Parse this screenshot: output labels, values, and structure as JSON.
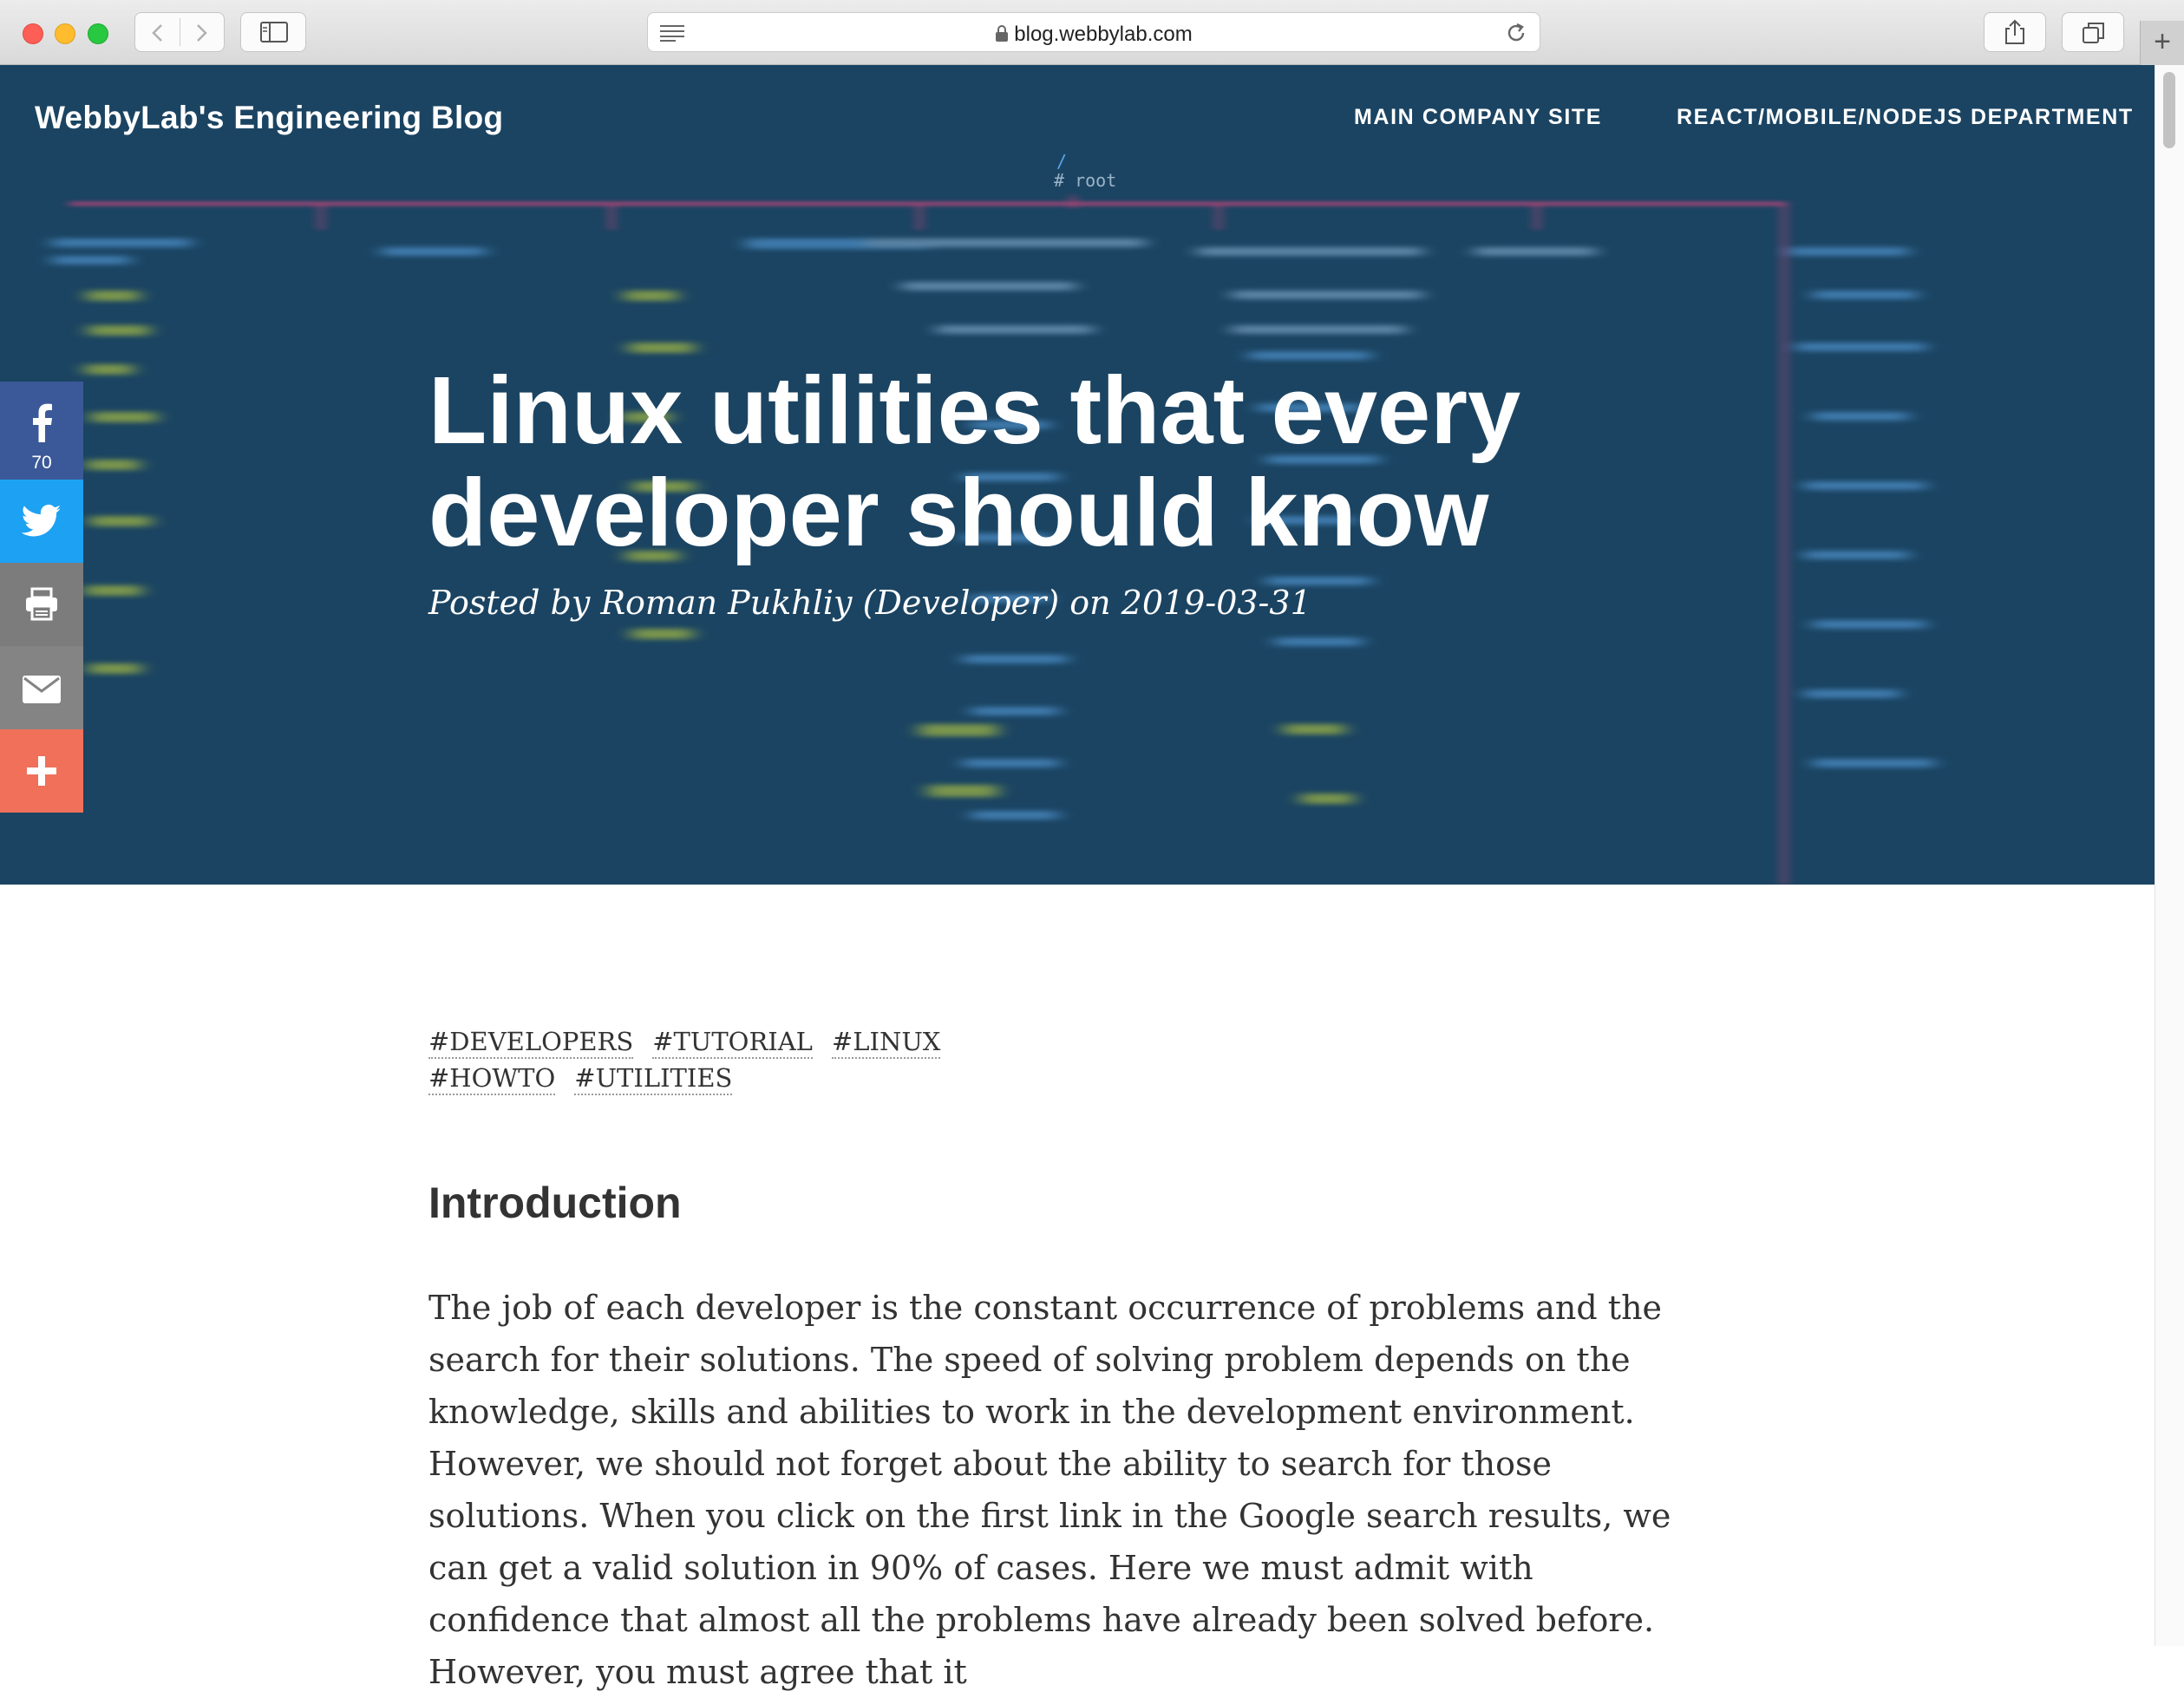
{
  "browser": {
    "url": "blog.webbylab.com"
  },
  "site": {
    "brand": "WebbyLab's Engineering Blog",
    "nav": [
      {
        "label": "MAIN COMPANY SITE"
      },
      {
        "label": "REACT/MOBILE/NODEJS DEPARTMENT"
      }
    ]
  },
  "hero": {
    "title": "Linux utilities that every developer should know",
    "meta": "Posted by Roman Pukhliy (Developer) on 2019-03-31",
    "bg_root_label": "# root",
    "bg_slash": "/"
  },
  "share": {
    "facebook_count": "70",
    "icons": [
      "facebook-icon",
      "twitter-icon",
      "print-icon",
      "email-icon",
      "plus-icon"
    ],
    "colors": {
      "facebook": "#3b5998",
      "twitter": "#1da1f2",
      "print": "#7c7c7c",
      "email": "#848484",
      "more": "#f0705a"
    }
  },
  "post": {
    "tags": [
      "#DEVELOPERS",
      "#TUTORIAL",
      "#LINUX",
      "#HOWTO",
      "#UTILITIES"
    ],
    "section_heading": "Introduction",
    "intro": "The job of each developer is the constant occurrence of problems and the search for their solutions. The speed of solving problem depends on the knowledge, skills and abilities to work in the development environment. However, we should not forget about the ability to search for those solutions. When you click on the first link in the Google search results, we can get a valid solution in 90% of cases. Here we must admit with confidence that almost all the problems have already been solved before. However, you must agree that it"
  },
  "colors": {
    "hero_bg": "#1b4462",
    "accent_pink": "#c0457a"
  }
}
